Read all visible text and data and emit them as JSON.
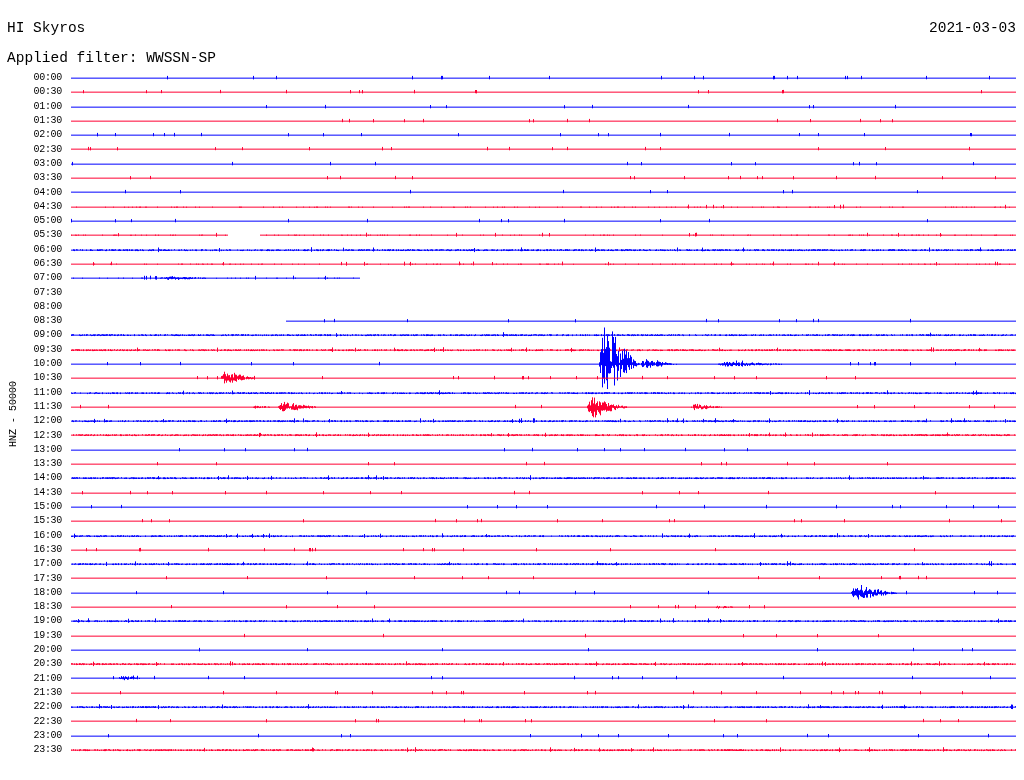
{
  "header": {
    "station": "HI Skyros",
    "date": "2021-03-03",
    "filter": "Applied filter: WWSSN-SP"
  },
  "axis_label": "HNZ - 50000",
  "rows": [
    {
      "time": "00:00",
      "color": "#0000ff",
      "kind": "full"
    },
    {
      "time": "00:30",
      "color": "#ff0033",
      "kind": "full"
    },
    {
      "time": "01:00",
      "color": "#0000ff",
      "kind": "full"
    },
    {
      "time": "01:30",
      "color": "#ff0033",
      "kind": "full"
    },
    {
      "time": "02:00",
      "color": "#0000ff",
      "kind": "full"
    },
    {
      "time": "02:30",
      "color": "#ff0033",
      "kind": "full"
    },
    {
      "time": "03:00",
      "color": "#0000ff",
      "kind": "full"
    },
    {
      "time": "03:30",
      "color": "#ff0033",
      "kind": "full"
    },
    {
      "time": "04:00",
      "color": "#0000ff",
      "kind": "full"
    },
    {
      "time": "04:30",
      "color": "#ff0033",
      "kind": "full"
    },
    {
      "time": "05:00",
      "color": "#0000ff",
      "kind": "full"
    },
    {
      "time": "05:30",
      "color": "#ff0033",
      "kind": "gap"
    },
    {
      "time": "06:00",
      "color": "#0000ff",
      "kind": "full"
    },
    {
      "time": "06:30",
      "color": "#ff0033",
      "kind": "full"
    },
    {
      "time": "07:00",
      "color": "#0000ff",
      "kind": "ends-early"
    },
    {
      "time": "07:30",
      "kind": "empty"
    },
    {
      "time": "08:00",
      "kind": "empty"
    },
    {
      "time": "08:30",
      "color": "#0000ff",
      "kind": "starts-late"
    },
    {
      "time": "09:00",
      "color": "#0000ff",
      "kind": "full"
    },
    {
      "time": "09:30",
      "color": "#ff0033",
      "kind": "full"
    },
    {
      "time": "10:00",
      "color": "#0000ff",
      "kind": "full"
    },
    {
      "time": "10:30",
      "color": "#ff0033",
      "kind": "full"
    },
    {
      "time": "11:00",
      "color": "#0000ff",
      "kind": "full"
    },
    {
      "time": "11:30",
      "color": "#ff0033",
      "kind": "full"
    },
    {
      "time": "12:00",
      "color": "#0000ff",
      "kind": "full"
    },
    {
      "time": "12:30",
      "color": "#ff0033",
      "kind": "full"
    },
    {
      "time": "13:00",
      "color": "#0000ff",
      "kind": "full"
    },
    {
      "time": "13:30",
      "color": "#ff0033",
      "kind": "full"
    },
    {
      "time": "14:00",
      "color": "#0000ff",
      "kind": "full"
    },
    {
      "time": "14:30",
      "color": "#ff0033",
      "kind": "full"
    },
    {
      "time": "15:00",
      "color": "#0000ff",
      "kind": "full"
    },
    {
      "time": "15:30",
      "color": "#ff0033",
      "kind": "full"
    },
    {
      "time": "16:00",
      "color": "#0000ff",
      "kind": "full"
    },
    {
      "time": "16:30",
      "color": "#ff0033",
      "kind": "full"
    },
    {
      "time": "17:00",
      "color": "#0000ff",
      "kind": "full"
    },
    {
      "time": "17:30",
      "color": "#ff0033",
      "kind": "full"
    },
    {
      "time": "18:00",
      "color": "#0000ff",
      "kind": "full"
    },
    {
      "time": "18:30",
      "color": "#ff0033",
      "kind": "full"
    },
    {
      "time": "19:00",
      "color": "#0000ff",
      "kind": "full"
    },
    {
      "time": "19:30",
      "color": "#ff0033",
      "kind": "full"
    },
    {
      "time": "20:00",
      "color": "#0000ff",
      "kind": "full"
    },
    {
      "time": "20:30",
      "color": "#ff0033",
      "kind": "full"
    },
    {
      "time": "21:00",
      "color": "#0000ff",
      "kind": "full"
    },
    {
      "time": "21:30",
      "color": "#ff0033",
      "kind": "full"
    },
    {
      "time": "22:00",
      "color": "#0000ff",
      "kind": "full"
    },
    {
      "time": "22:30",
      "color": "#ff0033",
      "kind": "full"
    },
    {
      "time": "23:00",
      "color": "#0000ff",
      "kind": "full"
    },
    {
      "time": "23:30",
      "color": "#ff0033",
      "kind": "full"
    }
  ]
}
